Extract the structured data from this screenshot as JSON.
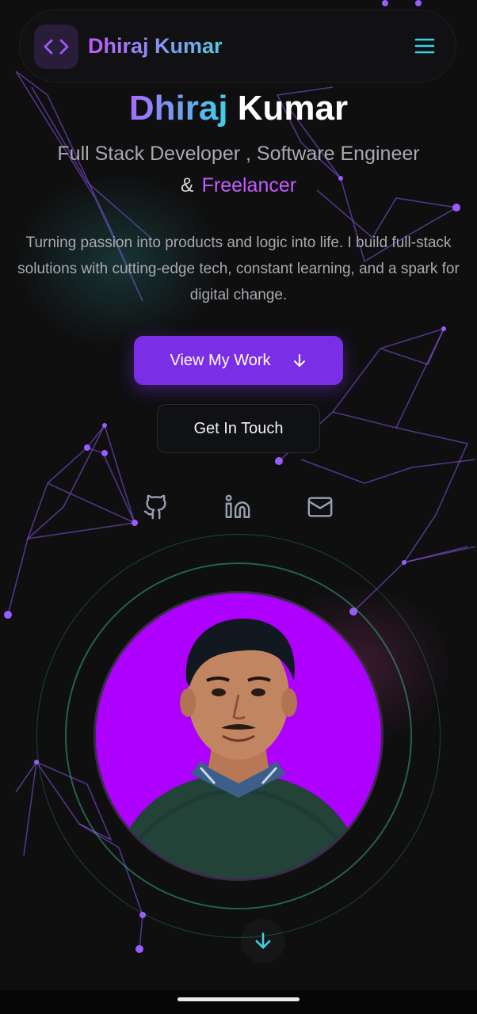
{
  "nav": {
    "brand": "Dhiraj Kumar",
    "logo_icon": "code-brackets-icon",
    "menu_icon": "hamburger-menu-icon"
  },
  "hero": {
    "name_first": "Dhiraj",
    "name_last": "Kumar",
    "role_line1": "Full Stack Developer , Software Engineer",
    "role_amp": "&",
    "role_highlight": "Freelancer",
    "description": "Turning passion into products and logic into life. I build full-stack solutions with cutting-edge tech, constant learning, and a spark for digital change."
  },
  "buttons": {
    "primary": "View My Work",
    "secondary": "Get In Touch"
  },
  "socials": [
    {
      "icon": "github-icon"
    },
    {
      "icon": "linkedin-icon"
    },
    {
      "icon": "mail-icon"
    }
  ],
  "colors": {
    "accent_purple": "#7a2ee6",
    "accent_teal": "#3fd0e6",
    "avatar_bg": "#ad00ff",
    "highlight": "#c25cff"
  }
}
